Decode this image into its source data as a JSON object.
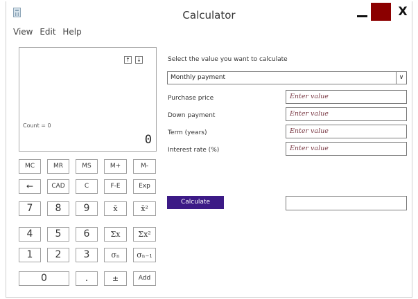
{
  "window": {
    "title": "Calculator",
    "close_glyph": "X"
  },
  "menu": {
    "items": [
      "View",
      "Edit",
      "Help"
    ]
  },
  "display": {
    "count_text": "Count = 0",
    "value": "0",
    "scroll_up": "↑",
    "scroll_down": "↓"
  },
  "keypad": {
    "row1": [
      "MC",
      "MR",
      "MS",
      "M+",
      "M-"
    ],
    "row2": [
      "←",
      "CAD",
      "C",
      "F-E",
      "Exp"
    ],
    "row3": [
      "7",
      "8",
      "9",
      "x̄",
      "x̄²"
    ],
    "row4": [
      "4",
      "5",
      "6",
      "Σx",
      "Σx²"
    ],
    "row5": [
      "1",
      "2",
      "3",
      "σₙ",
      "σₙ₋₁"
    ],
    "row6": [
      "0",
      ".",
      "±",
      "Add"
    ]
  },
  "worksheet": {
    "prompt": "Select the value you want to calculate",
    "selected_option": "Monthly payment",
    "fields": [
      {
        "label": "Purchase price",
        "placeholder": "Enter value"
      },
      {
        "label": "Down payment",
        "placeholder": "Enter value"
      },
      {
        "label": "Term (years)",
        "placeholder": "Enter value"
      },
      {
        "label": "Interest rate (%)",
        "placeholder": "Enter value"
      }
    ],
    "calculate_label": "Calculate",
    "result_value": ""
  },
  "colors": {
    "accent": "#3c1a86",
    "maximize_button": "#8b0000",
    "placeholder_text": "#7a3a45"
  }
}
